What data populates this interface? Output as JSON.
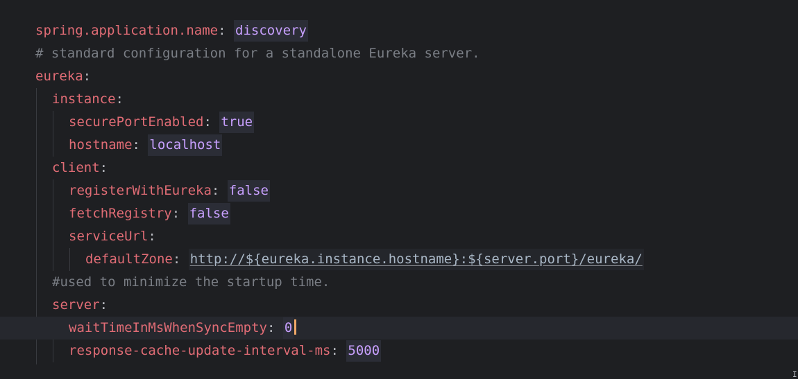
{
  "editor": {
    "lines": [
      {
        "key": "spring.application.name",
        "sep": ": ",
        "value": "discovery",
        "value_type": "str"
      },
      {
        "comment": "# standard configuration for a standalone Eureka server."
      },
      {
        "key": "eureka",
        "sep": ":"
      },
      {
        "key": "instance",
        "sep": ":"
      },
      {
        "key": "securePortEnabled",
        "sep": ": ",
        "value": "true",
        "value_type": "str"
      },
      {
        "key": "hostname",
        "sep": ": ",
        "value": "localhost",
        "value_type": "str"
      },
      {
        "key": "client",
        "sep": ":"
      },
      {
        "key": "registerWithEureka",
        "sep": ": ",
        "value": "false",
        "value_type": "str"
      },
      {
        "key": "fetchRegistry",
        "sep": ": ",
        "value": "false",
        "value_type": "str"
      },
      {
        "key": "serviceUrl",
        "sep": ":"
      },
      {
        "key": "defaultZone",
        "sep": ": ",
        "value": "http://${eureka.instance.hostname}:${server.port}/eureka/",
        "value_type": "link"
      },
      {
        "comment": "#used to minimize the startup time."
      },
      {
        "key": "server",
        "sep": ":"
      },
      {
        "key": "waitTimeInMsWhenSyncEmpty",
        "sep": ": ",
        "value": "0",
        "value_type": "num"
      },
      {
        "key": "response-cache-update-interval-ms",
        "sep": ": ",
        "value": "5000",
        "value_type": "num"
      }
    ]
  },
  "colors": {
    "background": "#1e1f22",
    "key": "#e06c75",
    "value": "#c8a0ff",
    "comment": "#7a7e85",
    "caret": "#f0a868"
  }
}
